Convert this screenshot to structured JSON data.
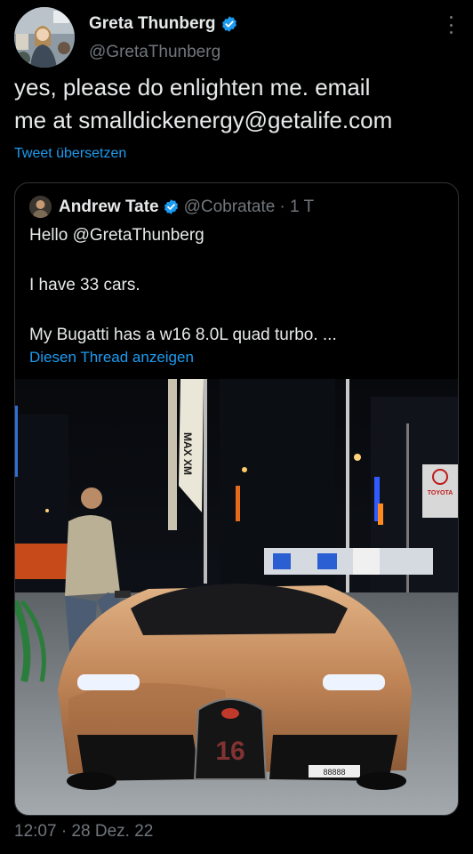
{
  "colors": {
    "background": "#000000",
    "text": "#e7e9ea",
    "muted": "#71767b",
    "link": "#1d9bf0",
    "verified": "#1d9bf0"
  },
  "tweet": {
    "author_name": "Greta Thunberg",
    "author_handle": "@GretaThunberg",
    "text": "yes, please do enlighten me. email\nme at smalldickenergy@getalife.com",
    "translate_label": "Tweet übersetzen",
    "timestamp": "12:07 · 28 Dez. 22"
  },
  "quoted": {
    "author_name": "Andrew Tate",
    "author_handle": "@Cobratate",
    "age": "· 1 T",
    "lines": [
      "Hello @GretaThunberg",
      "I have 33 cars.",
      "My Bugatti has a w16 8.0L quad turbo. ..."
    ],
    "thread_label": "Diesen Thread anzeigen",
    "photo": {
      "banner_text": "MAX XM",
      "sign_text": "TOYOTA",
      "plate_text": "88888"
    }
  },
  "icons": {
    "verified": "verified-badge-icon",
    "more": "more-options-icon"
  }
}
